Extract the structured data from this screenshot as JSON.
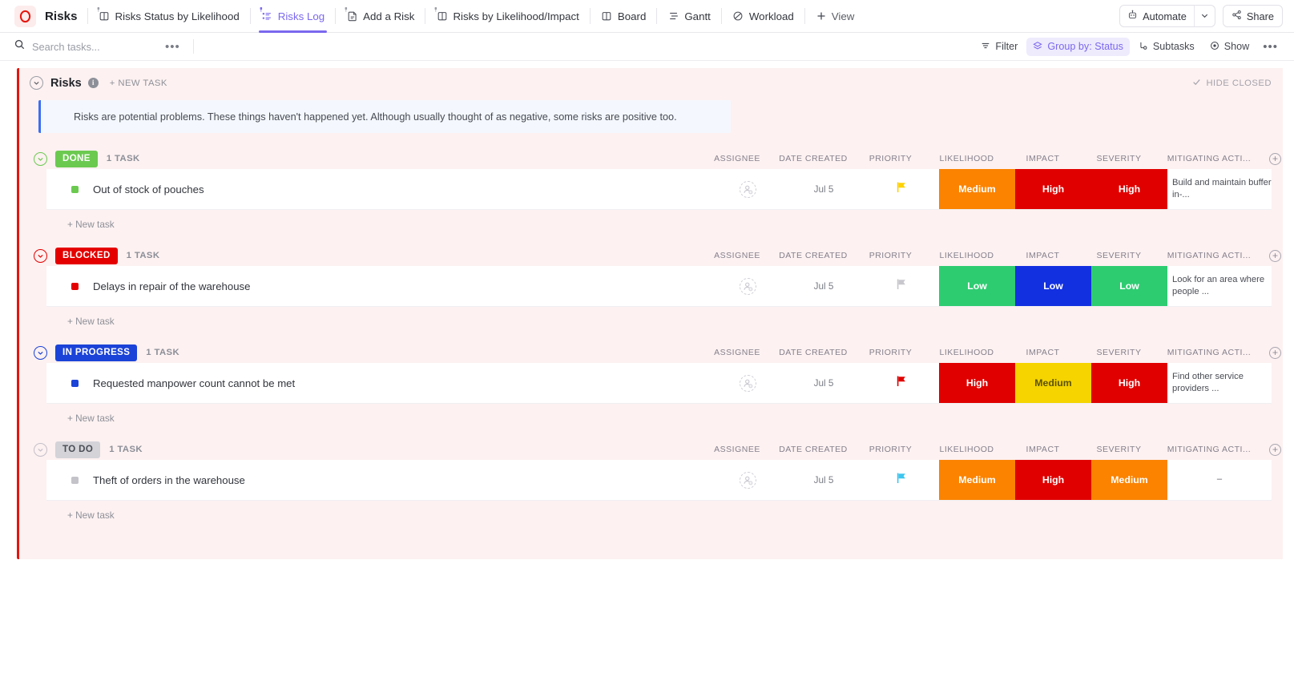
{
  "nav": {
    "brand": "Risks",
    "tabs": [
      {
        "label": "Risks Status by Likelihood",
        "icon": "board-icon",
        "active": false,
        "pinned": true
      },
      {
        "label": "Risks Log",
        "icon": "list-icon",
        "active": true,
        "pinned": true
      },
      {
        "label": "Add a Risk",
        "icon": "form-icon",
        "active": false,
        "pinned": true
      },
      {
        "label": "Risks by Likelihood/Impact",
        "icon": "board-icon",
        "active": false,
        "pinned": true
      },
      {
        "label": "Board",
        "icon": "board-icon",
        "active": false,
        "pinned": false
      },
      {
        "label": "Gantt",
        "icon": "gantt-icon",
        "active": false,
        "pinned": false
      },
      {
        "label": "Workload",
        "icon": "workload-icon",
        "active": false,
        "pinned": false
      }
    ],
    "add_view": "View",
    "automate": "Automate",
    "share": "Share"
  },
  "toolbar": {
    "search_placeholder": "Search tasks...",
    "search_value": "",
    "more": "•••",
    "filter": "Filter",
    "group_by": "Group by: Status",
    "subtasks": "Subtasks",
    "show": "Show",
    "overflow": "•••"
  },
  "list": {
    "name": "Risks",
    "new_task": "+ NEW TASK",
    "hide_closed": "HIDE CLOSED",
    "description": "Risks are potential problems. These things haven't happened yet. Although usually thought of as negative, some risks are positive too."
  },
  "columns": [
    "ASSIGNEE",
    "DATE CREATED",
    "PRIORITY",
    "LIKELIHOOD",
    "IMPACT",
    "SEVERITY",
    "MITIGATING ACTI..."
  ],
  "new_task_row": "+ New task",
  "colors": {
    "accent": "#7b68ee",
    "list_bar": "#e4160e",
    "board_bg": "#fdf1f1",
    "done": "#6bc950",
    "blocked": "#e50000",
    "in_progress": "#1b43d8",
    "todo": "#d3d3d8",
    "low_green": "#2ecc71",
    "low_blue": "#1330e0",
    "medium_orange": "#fb8300",
    "medium_yellow": "#f5d400",
    "high_red": "#e00000"
  },
  "groups": [
    {
      "status": "DONE",
      "status_color": "#6bc950",
      "status_text_color": "#ffffff",
      "circle_color": "#6bc950",
      "count": "1 TASK",
      "tasks": [
        {
          "name": "Out of stock of pouches",
          "dot_color": "#6bc950",
          "assignee": "",
          "date_created": "Jul 5",
          "priority": "yellow-flag",
          "priority_color": "#ffd200",
          "likelihood": "Medium",
          "likelihood_color": "#fb8300",
          "impact": "High",
          "impact_color": "#e00000",
          "severity": "High",
          "severity_color": "#e00000",
          "mitigating_action": "Build and maintain buffer in-..."
        }
      ]
    },
    {
      "status": "BLOCKED",
      "status_color": "#e50000",
      "status_text_color": "#ffffff",
      "circle_color": "#e50000",
      "count": "1 TASK",
      "tasks": [
        {
          "name": "Delays in repair of the warehouse",
          "dot_color": "#e50000",
          "assignee": "",
          "date_created": "Jul 5",
          "priority": "grey-flag",
          "priority_color": "#c7c7cd",
          "likelihood": "Low",
          "likelihood_color": "#2ecc71",
          "impact": "Low",
          "impact_color": "#1330e0",
          "severity": "Low",
          "severity_color": "#2ecc71",
          "mitigating_action": "Look for an area where people ..."
        }
      ]
    },
    {
      "status": "IN PROGRESS",
      "status_color": "#1b43d8",
      "status_text_color": "#ffffff",
      "circle_color": "#1b43d8",
      "count": "1 TASK",
      "tasks": [
        {
          "name": "Requested manpower count cannot be met",
          "dot_color": "#1b43d8",
          "assignee": "",
          "date_created": "Jul 5",
          "priority": "red-flag",
          "priority_color": "#e00000",
          "likelihood": "High",
          "likelihood_color": "#e00000",
          "impact": "Medium",
          "impact_color": "#f5d400",
          "impact_text_color": "#5c5200",
          "severity": "High",
          "severity_color": "#e00000",
          "mitigating_action": "Find other service providers ..."
        }
      ]
    },
    {
      "status": "TO DO",
      "status_color": "#d3d3d8",
      "status_text_color": "#4a4d55",
      "circle_color": "#c3c0c9",
      "count": "1 TASK",
      "tasks": [
        {
          "name": "Theft of orders in the warehouse",
          "dot_color": "#c3c3c9",
          "assignee": "",
          "date_created": "Jul 5",
          "priority": "blue-flag",
          "priority_color": "#3ec6ef",
          "likelihood": "Medium",
          "likelihood_color": "#fb8300",
          "impact": "High",
          "impact_color": "#e00000",
          "severity": "Medium",
          "severity_color": "#fb8300",
          "mitigating_action": "–"
        }
      ]
    }
  ]
}
